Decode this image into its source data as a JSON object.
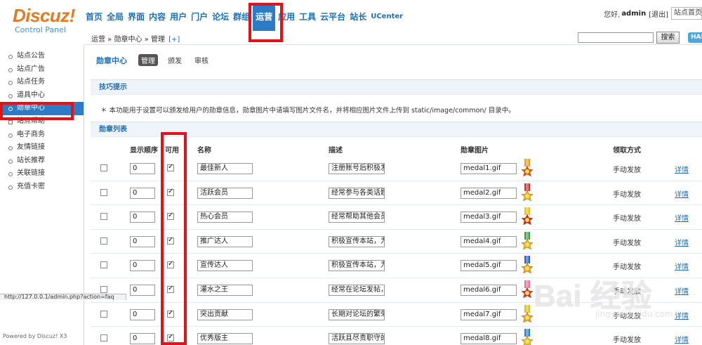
{
  "brand": {
    "logo_text": "Discuz!",
    "sub_text": "Control Panel"
  },
  "topnav": [
    {
      "label": "首页",
      "active": false
    },
    {
      "label": "全局",
      "active": false
    },
    {
      "label": "界面",
      "active": false
    },
    {
      "label": "内容",
      "active": false
    },
    {
      "label": "用户",
      "active": false
    },
    {
      "label": "门户",
      "active": false
    },
    {
      "label": "论坛",
      "active": false
    },
    {
      "label": "群组",
      "active": false
    },
    {
      "label": "运营",
      "active": true
    },
    {
      "label": "应用",
      "active": false
    },
    {
      "label": "工具",
      "active": false
    },
    {
      "label": "云平台",
      "active": false
    },
    {
      "label": "站长",
      "active": false
    },
    {
      "label": "UCenter",
      "active": false
    }
  ],
  "userbar": {
    "greeting": "您好,",
    "username": "admin",
    "logout": "[退出]",
    "site_select": "站点首页"
  },
  "breadcrumb": {
    "path": "运营 » 勋章中心 » 管理",
    "plus": "[+]"
  },
  "search": {
    "button": "搜索",
    "hai": "HAI"
  },
  "sidebar": {
    "items": [
      {
        "label": "站点公告",
        "active": false
      },
      {
        "label": "站点广告",
        "active": false
      },
      {
        "label": "站点任务",
        "active": false
      },
      {
        "label": "道具中心",
        "active": false
      },
      {
        "label": "勋章中心",
        "active": true
      },
      {
        "label": "站点帮助",
        "active": false
      },
      {
        "label": "电子商务",
        "active": false
      },
      {
        "label": "友情链接",
        "active": false
      },
      {
        "label": "站长推荐",
        "active": false
      },
      {
        "label": "关联链接",
        "active": false
      },
      {
        "label": "充值卡密",
        "active": false
      }
    ],
    "powered": "Powered by Discuz! X3",
    "status_url": "http://127.0.0.1/admin.php?action=faq"
  },
  "page": {
    "title": "勋章中心",
    "tabs": [
      {
        "label": "管理",
        "active": true
      },
      {
        "label": "颁发",
        "active": false
      },
      {
        "label": "审核",
        "active": false
      }
    ],
    "tips_title": "技巧提示",
    "tips_text": "本功能用于设置可以颁发给用户的勋章信息，勋章图片中请填写图片文件名，并将相应图片文件上传到 static/image/common/ 目录中。",
    "list_title": "勋章列表",
    "columns": {
      "order": "显示顺序",
      "enabled": "可用",
      "name": "名称",
      "desc": "描述",
      "image": "勋章图片",
      "method": "领取方式"
    }
  },
  "medals": [
    {
      "order": "0",
      "enabled": true,
      "name": "最佳新人",
      "desc": "注册账号后积极发帖",
      "image": "medal1.gif",
      "method": "手动发放",
      "detail": "详情",
      "ribbon": "#e8a020",
      "star": "#e85010"
    },
    {
      "order": "0",
      "enabled": true,
      "name": "活跃会员",
      "desc": "经常参与各类话题的",
      "image": "medal2.gif",
      "method": "手动发放",
      "detail": "详情",
      "ribbon": "#d83030",
      "star": "#f0b020"
    },
    {
      "order": "0",
      "enabled": true,
      "name": "热心会员",
      "desc": "经常帮助其他会员答",
      "image": "medal3.gif",
      "method": "手动发放",
      "detail": "详情",
      "ribbon": "#e8c020",
      "star": "#d82020"
    },
    {
      "order": "0",
      "enabled": true,
      "name": "推广达人",
      "desc": "积极宣传本站，为本",
      "image": "medal4.gif",
      "method": "手动发放",
      "detail": "详情",
      "ribbon": "#40a040",
      "star": "#e8b020"
    },
    {
      "order": "0",
      "enabled": true,
      "name": "宣传达人",
      "desc": "积极宣传本站，为本",
      "image": "medal5.gif",
      "method": "手动发放",
      "detail": "详情",
      "ribbon": "#3060c0",
      "star": "#e8a020"
    },
    {
      "order": "0",
      "enabled": true,
      "name": "灌水之王",
      "desc": "经常在论坛发帖，且",
      "image": "medal6.gif",
      "method": "手动发放",
      "detail": "详情",
      "ribbon": "#e870a0",
      "star": "#d83030"
    },
    {
      "order": "0",
      "enabled": true,
      "name": "突出贡献",
      "desc": "长期对论坛的繁荣而",
      "image": "medal7.gif",
      "method": "手动发放",
      "detail": "详情",
      "ribbon": "#d8c020",
      "star": "#e8a020"
    },
    {
      "order": "0",
      "enabled": true,
      "name": "优秀版主",
      "desc": "活跃且尽责职守的版",
      "image": "medal8.gif",
      "method": "手动发放",
      "detail": "详情",
      "ribbon": "#3080d0",
      "star": "#e8c020"
    }
  ],
  "watermark": {
    "big": "Bai 经验",
    "small": "jingyan.baidu.com"
  }
}
